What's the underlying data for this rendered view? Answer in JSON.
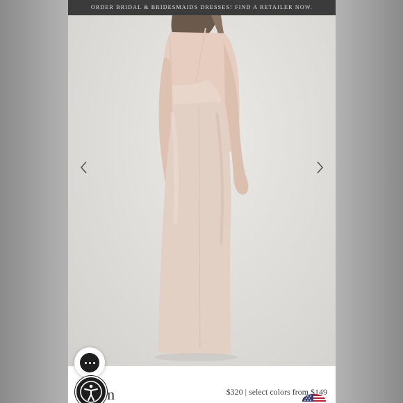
{
  "banner": {
    "text": "ORDER BRIDAL & BRIDESMAIDS DRESSES! FIND A RETAILER NOW."
  },
  "carousel": {
    "prev_icon": "chevron-left-icon",
    "next_icon": "chevron-right-icon"
  },
  "product": {
    "name": "Lauren",
    "visible_name_fragment": "ren",
    "price_text": "$320 | select colors from $149"
  },
  "widgets": {
    "chat_icon": "chat-dots-icon",
    "accessibility_icon": "accessibility-icon",
    "flag_icon": "us-flag-icon"
  },
  "colors": {
    "banner_bg": "#3b3b3b",
    "dress": "#e2cfc4",
    "photo_bg": "#e0dedb"
  }
}
